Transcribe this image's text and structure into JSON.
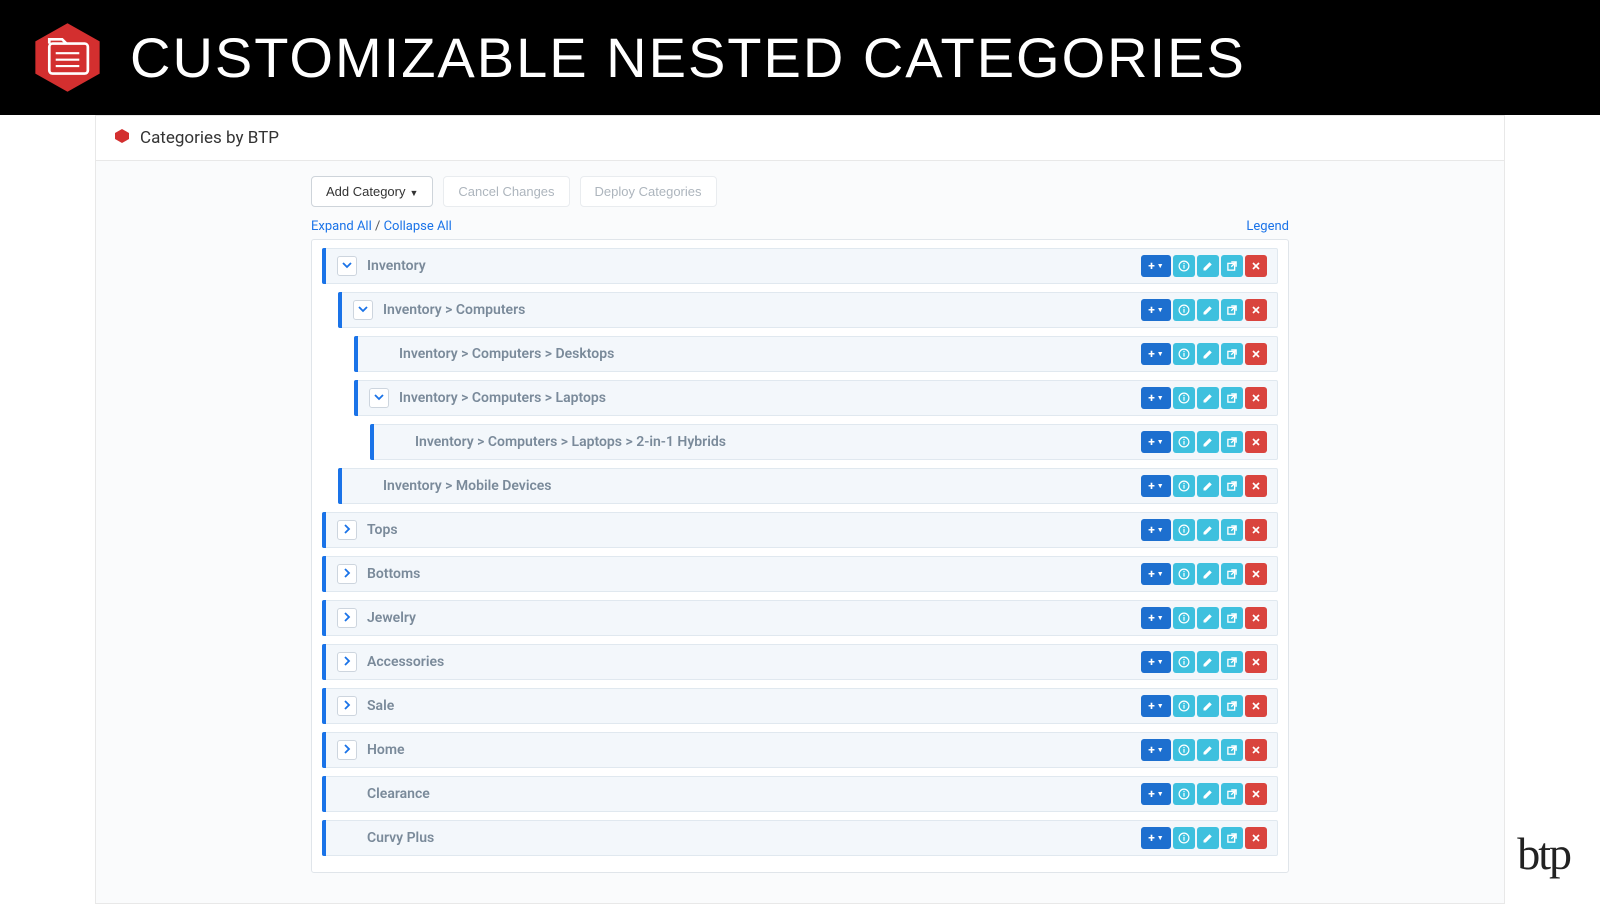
{
  "header": {
    "title": "CUSTOMIZABLE NESTED CATEGORIES",
    "icon": "folder-list-icon"
  },
  "app": {
    "title": "Categories by BTP",
    "icon": "box-icon"
  },
  "toolbar": {
    "add_label": "Add Category",
    "cancel_label": "Cancel Changes",
    "deploy_label": "Deploy Categories"
  },
  "meta": {
    "expand_label": "Expand All",
    "separator": "/",
    "collapse_label": "Collapse All",
    "legend_label": "Legend"
  },
  "actions": {
    "add_icon": "plus-icon",
    "info_icon": "info-icon",
    "edit_icon": "pencil-icon",
    "link_icon": "external-icon",
    "delete_icon": "close-icon"
  },
  "tree": [
    {
      "label": "Inventory",
      "indent": 0,
      "toggle": "down"
    },
    {
      "label": "Inventory > Computers",
      "indent": 1,
      "toggle": "down"
    },
    {
      "label": "Inventory > Computers > Desktops",
      "indent": 2,
      "toggle": "none"
    },
    {
      "label": "Inventory > Computers > Laptops",
      "indent": 2,
      "toggle": "down"
    },
    {
      "label": "Inventory > Computers > Laptops > 2-in-1 Hybrids",
      "indent": 3,
      "toggle": "none"
    },
    {
      "label": "Inventory > Mobile Devices",
      "indent": 1,
      "toggle": "none"
    },
    {
      "label": "Tops",
      "indent": 0,
      "toggle": "right"
    },
    {
      "label": "Bottoms",
      "indent": 0,
      "toggle": "right"
    },
    {
      "label": "Jewelry",
      "indent": 0,
      "toggle": "right"
    },
    {
      "label": "Accessories",
      "indent": 0,
      "toggle": "right"
    },
    {
      "label": "Sale",
      "indent": 0,
      "toggle": "right"
    },
    {
      "label": "Home",
      "indent": 0,
      "toggle": "right"
    },
    {
      "label": "Clearance",
      "indent": 0,
      "toggle": "none"
    },
    {
      "label": "Curvy Plus",
      "indent": 0,
      "toggle": "none"
    }
  ],
  "footer": {
    "logo_text": "btp"
  }
}
